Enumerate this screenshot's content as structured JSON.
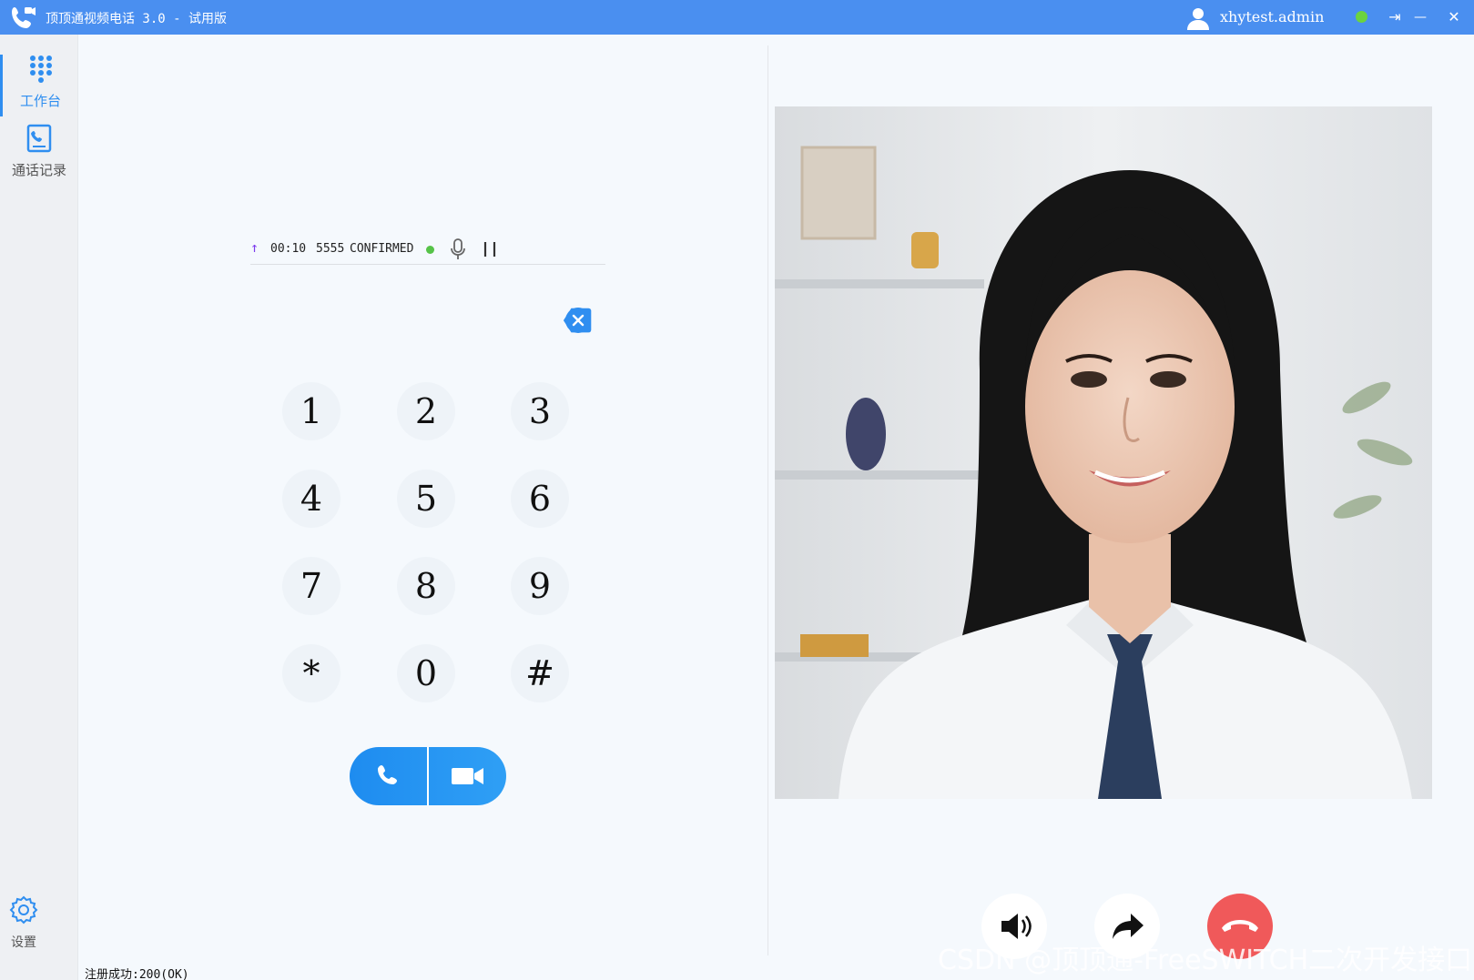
{
  "window": {
    "title": "顶顶通视频电话 3.0 - 试用版",
    "username": "xhytest.admin",
    "controls": {
      "popout": "⇥",
      "minimize": "—",
      "close": "✕"
    },
    "status_color": "#6bd33f"
  },
  "sidebar": {
    "items": [
      {
        "label": "工作台",
        "icon": "dialpad-icon",
        "active": true
      },
      {
        "label": "通话记录",
        "icon": "call-log-icon",
        "active": false
      }
    ],
    "settings_label": "设置"
  },
  "call": {
    "direction": "outgoing",
    "arrow": "↑",
    "duration": "00:10",
    "number": "5555",
    "state": "CONFIRMED"
  },
  "keypad": [
    "1",
    "2",
    "3",
    "4",
    "5",
    "6",
    "7",
    "8",
    "9",
    "*",
    "0",
    "#"
  ],
  "dial_buttons": {
    "audio": "phone-icon",
    "video": "video-camera-icon"
  },
  "call_controls": [
    "speaker-icon",
    "transfer-icon",
    "hangup-icon"
  ],
  "footer": {
    "registration": "注册成功:200(OK)"
  },
  "watermark": "CSDN @顶顶通-FreeSWITCH二次开发接口",
  "colors": {
    "titlebar": "#4a8ff0",
    "accent": "#2f8ef0",
    "hangup": "#f0595a"
  }
}
